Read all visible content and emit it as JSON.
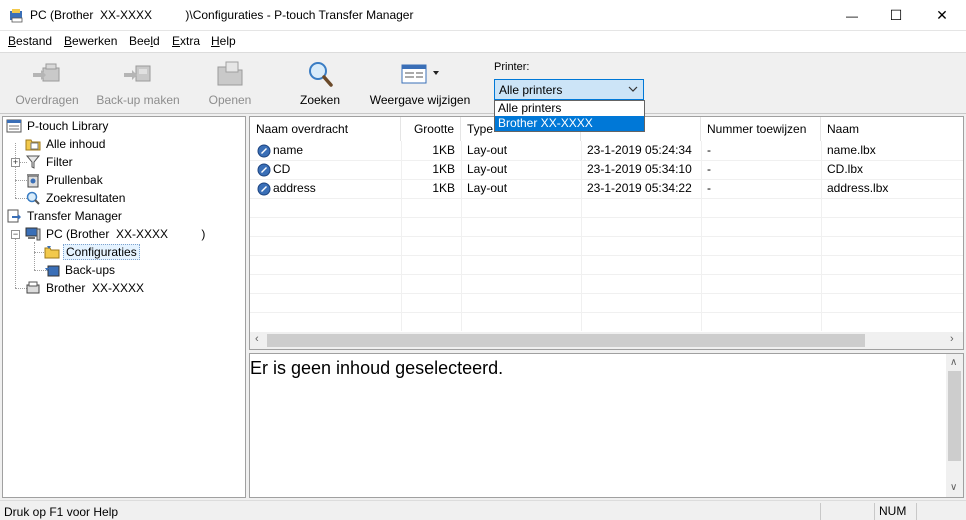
{
  "window": {
    "title": "PC (Brother  XX-XXXX          )\\Configuraties - P-touch Transfer Manager",
    "minimize_glyph": "—",
    "maximize_glyph": "☐",
    "close_glyph": "✕"
  },
  "menu": [
    {
      "mnemonic": "B",
      "rest": "estand"
    },
    {
      "mnemonic": "B",
      "rest": "ewerken"
    },
    {
      "pre": "Bee",
      "mnemonic": "l",
      "rest": "d"
    },
    {
      "mnemonic": "E",
      "rest": "xtra"
    },
    {
      "mnemonic": "H",
      "rest": "elp"
    }
  ],
  "toolbar": {
    "transfer_label": "Overdragen",
    "backup_label": "Back-up maken",
    "open_label": "Openen",
    "search_label": "Zoeken",
    "view_label": "Weergave wijzigen",
    "printer_label": "Printer:",
    "printer_selected": "Alle printers",
    "printer_options": [
      "Alle printers",
      "Brother XX-XXXX"
    ]
  },
  "tree": {
    "library": "P-touch Library",
    "all_content": "Alle inhoud",
    "filter": "Filter",
    "trash": "Prullenbak",
    "search_results": "Zoekresultaten",
    "transfer_manager": "Transfer Manager",
    "pc": "PC (Brother  XX-XXXX          )",
    "configurations": "Configuraties",
    "backups": "Back-ups",
    "brother": "Brother  XX-XXXX"
  },
  "list": {
    "columns": [
      "Naam overdracht",
      "Grootte",
      "Type",
      "",
      "Nummer toewijzen",
      "Naam"
    ],
    "rows": [
      {
        "name": "name",
        "size": "1KB",
        "type": "Lay-out",
        "date": "23-1-2019 05:24:34",
        "number": "-",
        "file": "name.lbx"
      },
      {
        "name": "CD",
        "size": "1KB",
        "type": "Lay-out",
        "date": "23-1-2019 05:34:10",
        "number": "-",
        "file": "CD.lbx"
      },
      {
        "name": "address",
        "size": "1KB",
        "type": "Lay-out",
        "date": "23-1-2019 05:34:22",
        "number": "-",
        "file": "address.lbx"
      }
    ]
  },
  "preview": {
    "text": "Er is geen inhoud geselecteerd."
  },
  "status": {
    "help": "Druk op F1 voor Help",
    "num": "NUM"
  },
  "colors": {
    "accent": "#0078d7",
    "select_bg": "#cce4f7"
  }
}
